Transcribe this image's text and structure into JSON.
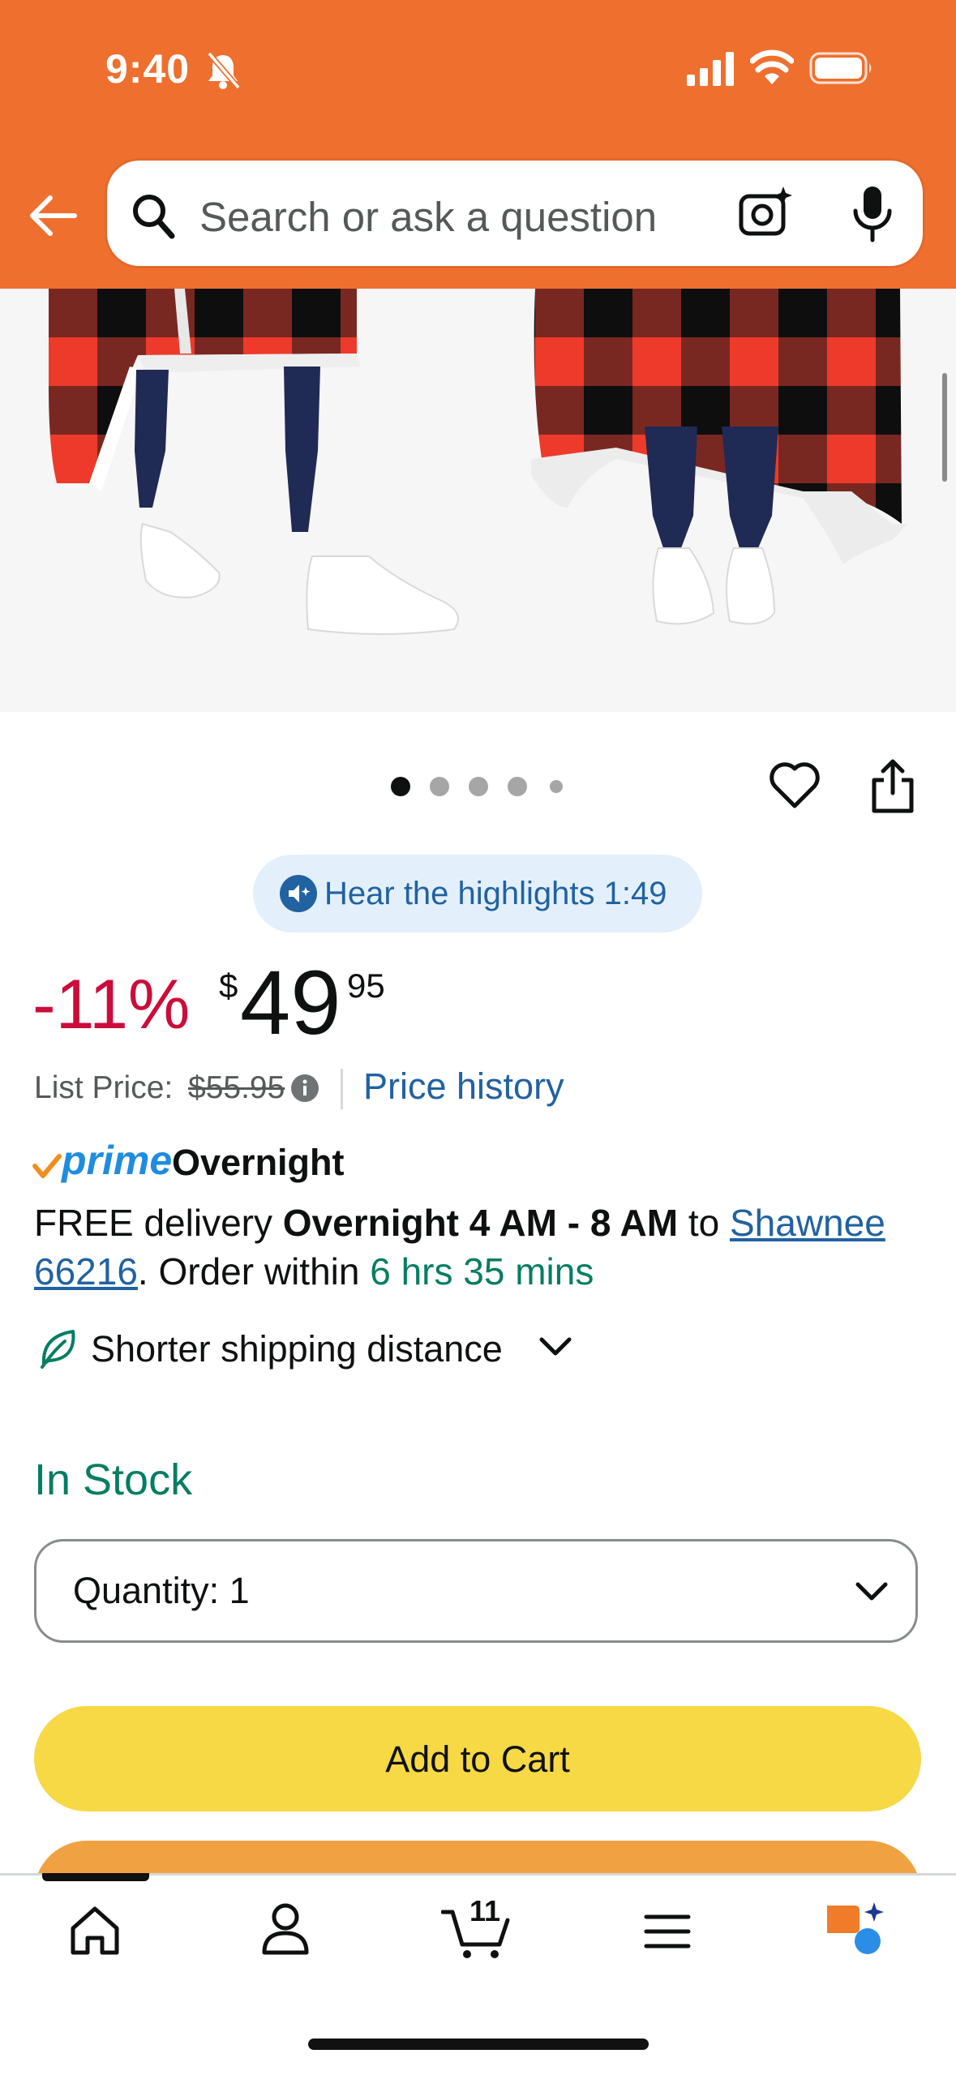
{
  "status_bar": {
    "time": "9:40"
  },
  "search": {
    "placeholder": "Search or ask a question"
  },
  "carousel": {
    "total_dots": 5,
    "active_dot": 1
  },
  "audio": {
    "label": "Hear the highlights 1:49"
  },
  "price": {
    "discount": "-11%",
    "currency": "$",
    "whole": "49",
    "fraction": "95",
    "list_price_label": "List Price:",
    "list_price_value": "$55.95",
    "history_link": "Price history"
  },
  "delivery": {
    "prime": "prime",
    "prime_speed": "Overnight",
    "free_delivery": "FREE delivery ",
    "window": "Overnight 4 AM - 8 AM",
    "to": " to ",
    "location": "Shawnee 66216",
    "order_within": ". Order within ",
    "countdown": "6 hrs 35 mins"
  },
  "shipping": {
    "label": "Shorter shipping distance"
  },
  "stock": {
    "status": "In Stock"
  },
  "quantity": {
    "label": "Quantity:",
    "value": "1"
  },
  "buttons": {
    "add_to_cart": "Add to Cart"
  },
  "nav": {
    "cart_count": "11"
  },
  "colors": {
    "header": "#ef6f2e",
    "deal": "#cc0c39",
    "link": "#2162a1",
    "success": "#067d62",
    "add_to_cart": "#f7d845",
    "buy_now": "#f0a243"
  }
}
